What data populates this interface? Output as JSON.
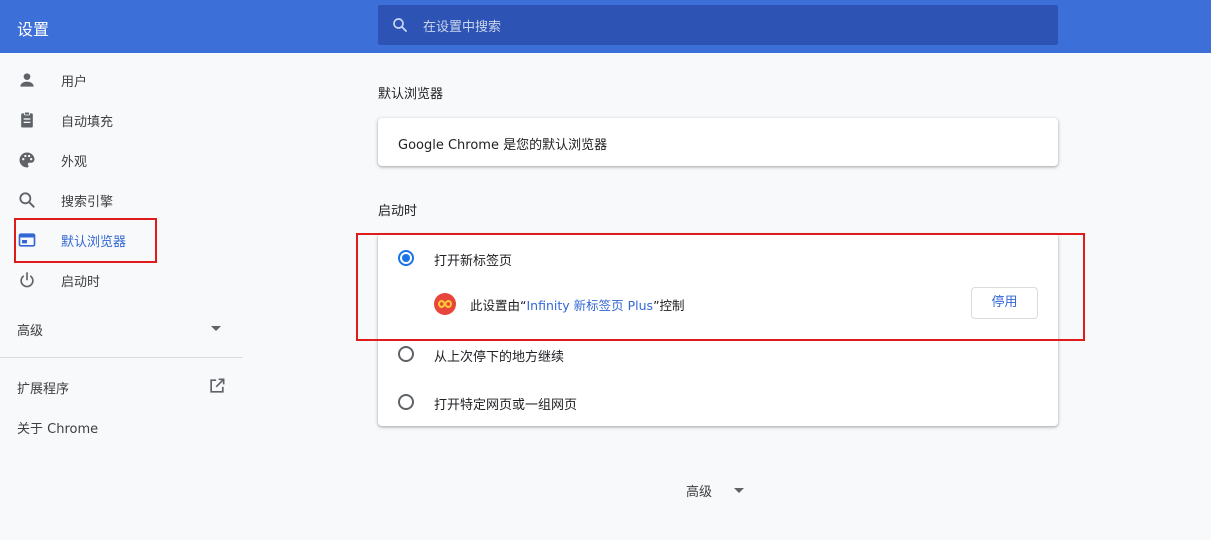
{
  "header": {
    "title": "设置",
    "search_placeholder": "在设置中搜索",
    "bar_color": "#3d6fd9"
  },
  "sidebar": {
    "items": [
      {
        "label": "用户",
        "icon": "person-icon"
      },
      {
        "label": "自动填充",
        "icon": "clipboard-icon"
      },
      {
        "label": "外观",
        "icon": "palette-icon"
      },
      {
        "label": "搜索引擎",
        "icon": "search-icon"
      },
      {
        "label": "默认浏览器",
        "icon": "browser-window-icon",
        "active": true
      },
      {
        "label": "启动时",
        "icon": "power-icon"
      }
    ],
    "advanced_label": "高级",
    "extensions_label": "扩展程序",
    "about_label": "关于 Chrome"
  },
  "default_browser": {
    "section_title": "默认浏览器",
    "status_text": "Google Chrome 是您的默认浏览器"
  },
  "on_startup": {
    "section_title": "启动时",
    "options": [
      {
        "label": "打开新标签页",
        "checked": true
      },
      {
        "label": "从上次停下的地方继续",
        "checked": false
      },
      {
        "label": "打开特定网页或一组网页",
        "checked": false
      }
    ],
    "controlled_prefix": "此设置由“",
    "extension_name": "Infinity 新标签页 Plus",
    "controlled_suffix": "”控制",
    "disable_button": "停用"
  },
  "bottom": {
    "advanced_label": "高级"
  },
  "colors": {
    "accent": "#1a73e8",
    "link": "#3367d6",
    "annotation_red": "#e01b1b"
  }
}
